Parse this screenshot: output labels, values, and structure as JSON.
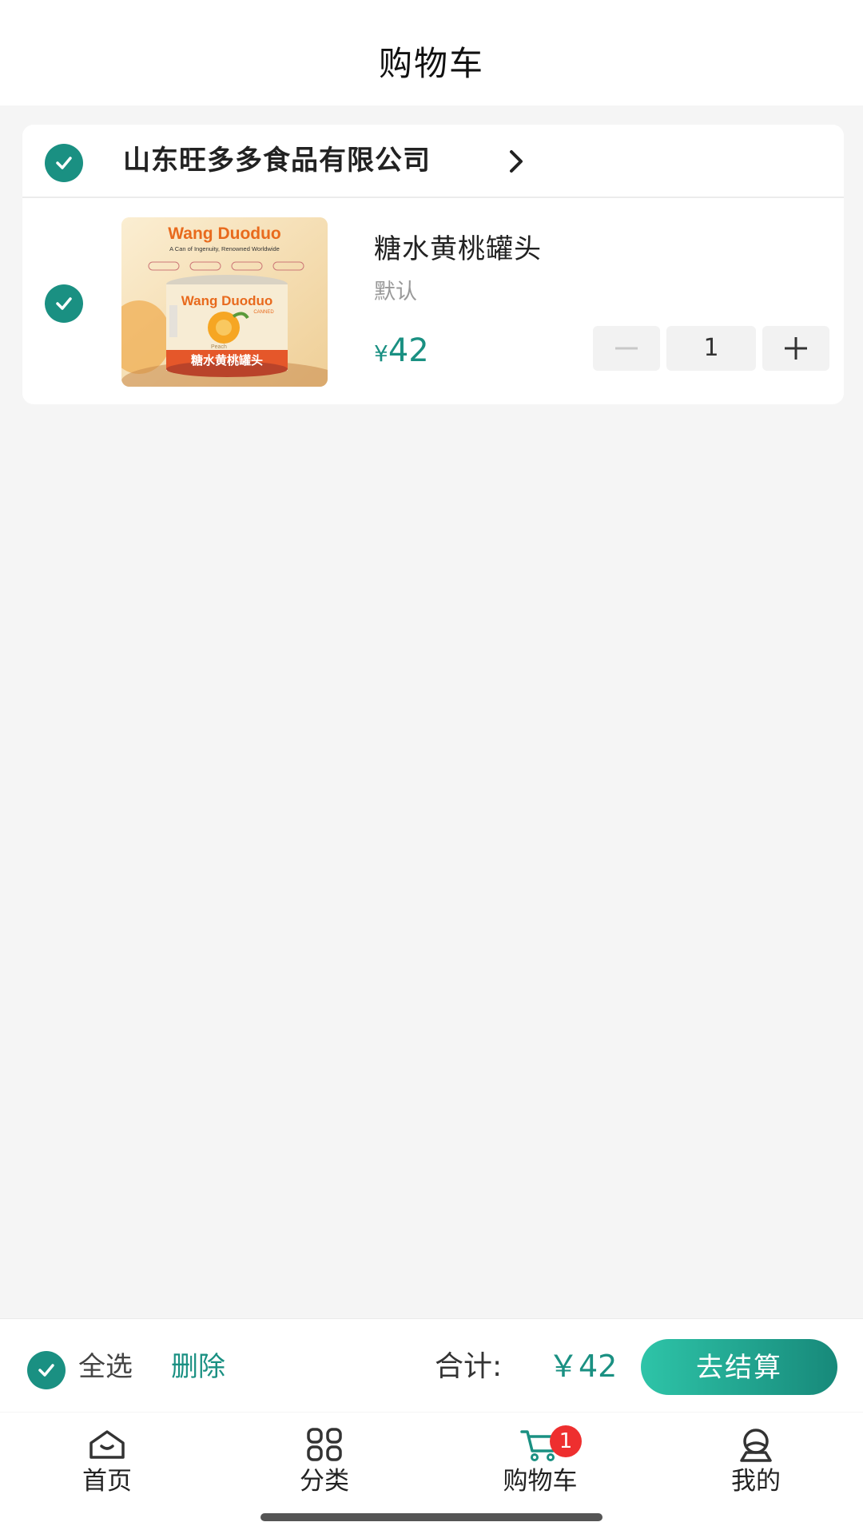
{
  "header": {
    "title": "购物车"
  },
  "store": {
    "name": "山东旺多多食品有限公司"
  },
  "item": {
    "product_image_brand": "Wang Duoduo",
    "product_image_tagline": "A Can of Ingenuity, Renowned Worldwide",
    "product_image_can_label": "糖水黄桃罐头",
    "product_image_flavor": "Peach",
    "product_image_canned": "CANNED",
    "name": "糖水黄桃罐头",
    "spec": "默认",
    "price_symbol": "¥",
    "price": "42",
    "quantity": "1"
  },
  "footer": {
    "select_all_label": "全选",
    "delete_label": "删除",
    "total_label": "合计:",
    "total_value": "￥42",
    "checkout_label": "去结算"
  },
  "tabs": [
    {
      "label": "首页",
      "icon": "home-icon"
    },
    {
      "label": "分类",
      "icon": "grid-icon"
    },
    {
      "label": "购物车",
      "icon": "cart-icon",
      "badge": "1"
    },
    {
      "label": "我的",
      "icon": "profile-icon"
    }
  ],
  "colors": {
    "accent": "#1a9082",
    "badge": "#ee2f2f",
    "background": "#f5f5f5"
  }
}
